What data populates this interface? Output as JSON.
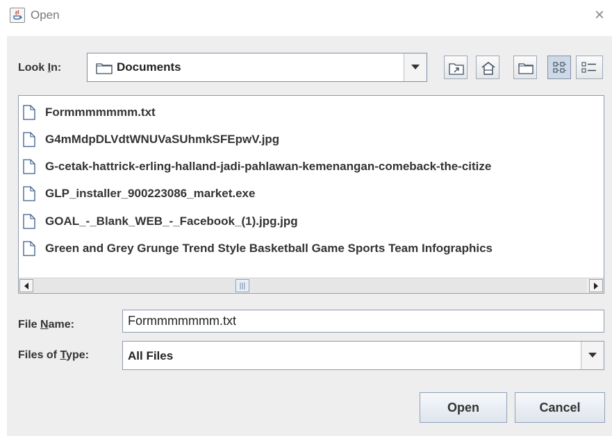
{
  "window": {
    "title": "Open",
    "close_glyph": "×"
  },
  "look_in": {
    "label_prefix": "Look ",
    "label_mnemonic": "I",
    "label_suffix": "n:",
    "value": "Documents"
  },
  "toolbar": {
    "buttons": [
      {
        "name": "up-one-level",
        "icon": "up-folder-icon"
      },
      {
        "name": "home",
        "icon": "home-icon"
      },
      {
        "name": "create-new-folder",
        "icon": "new-folder-icon"
      },
      {
        "name": "list-view",
        "icon": "list-view-icon",
        "pressed": true
      },
      {
        "name": "details-view",
        "icon": "details-view-icon",
        "pressed": false
      }
    ]
  },
  "files": [
    "Formmmmmmm.txt",
    "G4mMdpDLVdtWNUVaSUhmkSFEpwV.jpg",
    "G-cetak-hattrick-erling-halland-jadi-pahlawan-kemenangan-comeback-the-citize",
    "GLP_installer_900223086_market.exe",
    "GOAL_-_Blank_WEB_-_Facebook_(1).jpg.jpg",
    "Green  and Grey Grunge Trend Style Basketball Game Sports Team Infographics"
  ],
  "file_name": {
    "label_prefix": "File ",
    "label_mnemonic": "N",
    "label_suffix": "ame:",
    "value": "Formmmmmmm.txt"
  },
  "file_type": {
    "label_prefix": "Files of ",
    "label_mnemonic": "T",
    "label_suffix": "ype:",
    "value": "All Files"
  },
  "buttons": {
    "open": "Open",
    "cancel": "Cancel"
  }
}
